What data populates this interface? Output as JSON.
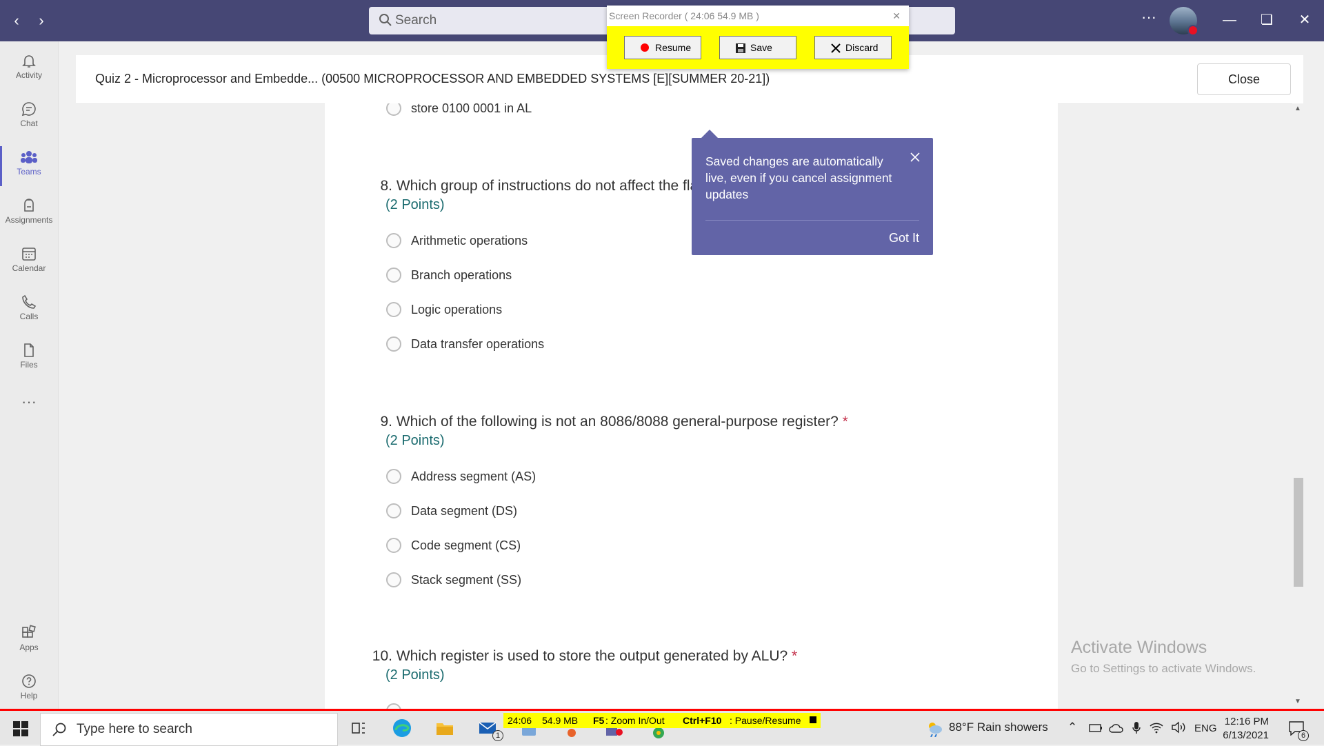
{
  "topbar": {
    "search_placeholder": "Search",
    "more_label": "···"
  },
  "rail": {
    "items": [
      {
        "label": "Activity"
      },
      {
        "label": "Chat"
      },
      {
        "label": "Teams"
      },
      {
        "label": "Assignments"
      },
      {
        "label": "Calendar"
      },
      {
        "label": "Calls"
      },
      {
        "label": "Files"
      },
      {
        "label": "···"
      },
      {
        "label": "Apps"
      },
      {
        "label": "Help"
      }
    ]
  },
  "header": {
    "title": "Quiz 2 - Microprocessor and Embedde... (00500 MICROPROCESSOR AND EMBEDDED SYSTEMS [E][SUMMER 20-21])",
    "close_label": "Close"
  },
  "form": {
    "prev_option": "store 0100 0001 in AL",
    "questions": [
      {
        "number": "8.",
        "text": "Which group of instructions do not affect the fla",
        "points": "(2 Points)",
        "required": "",
        "options": [
          "Arithmetic operations",
          "Branch operations",
          "Logic operations",
          "Data transfer operations"
        ]
      },
      {
        "number": "9.",
        "text": "Which of the following is not an 8086/8088 general-purpose register?",
        "points": "(2 Points)",
        "required": "*",
        "options": [
          "Address segment (AS)",
          "Data segment (DS)",
          "Code segment (CS)",
          "Stack segment (SS)"
        ]
      },
      {
        "number": "10.",
        "text": "Which register is used to store the output generated by ALU?",
        "points": "(2 Points)",
        "required": "*",
        "options": []
      }
    ]
  },
  "tooltip": {
    "message": "Saved changes are automatically live, even if you cancel assignment updates",
    "got_it": "Got It"
  },
  "recorder": {
    "title": "Screen Recorder ( 24:06   54.9 MB )",
    "resume": "Resume",
    "save": "Save",
    "discard": "Discard"
  },
  "watermark": {
    "line1": "Activate Windows",
    "line2": "Go to Settings to activate Windows."
  },
  "taskbar": {
    "search_placeholder": "Type here to search",
    "mail_badge": "1",
    "rec_time": "24:06",
    "rec_size": "54.9 MB",
    "rec_zoom_key": "F5",
    "rec_zoom_text": ": Zoom In/Out",
    "rec_pause_key": "Ctrl+F10",
    "rec_pause_text": ": Pause/Resume",
    "weather": "88°F  Rain showers",
    "language": "ENG",
    "time": "12:16 PM",
    "date": "6/13/2021",
    "notification_count": "6"
  }
}
